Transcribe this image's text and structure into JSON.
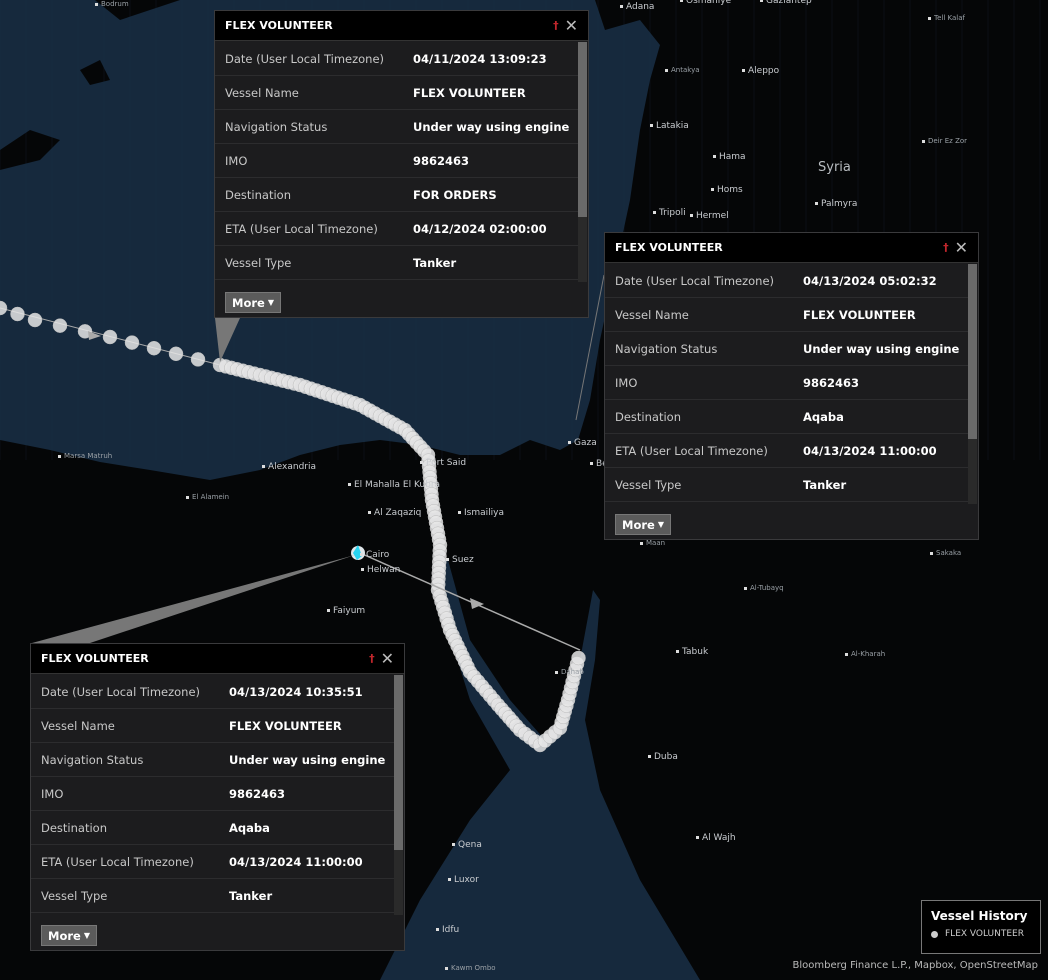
{
  "map": {
    "labels": [
      "Bodrum",
      "Adana",
      "Osmaniye",
      "Gaziantep",
      "Tell Kalaf",
      "Antakya",
      "Aleppo",
      "Latakia",
      "Hama",
      "Syria",
      "Deir Ez Zor",
      "Homs",
      "Tripoli",
      "Hermel",
      "Palmyra",
      "Marsa Matruh",
      "Alexandria",
      "El Mahalla El Kubra",
      "El Alamein",
      "Al Zaqaziq",
      "Ismailiya",
      "Port Said",
      "Gaza",
      "Beersheba",
      "Cairo",
      "Helwan",
      "Suez",
      "Faiyum",
      "Dahab",
      "Tabuk",
      "Duba",
      "Al Wajh",
      "Qena",
      "Luxor",
      "Idfu",
      "Kawm Ombo",
      "Maan",
      "Al-Tubayq",
      "Sakaka",
      "Al-Kharah"
    ],
    "track_color": "#e6e6e6",
    "sea_color": "#16293d",
    "current_position_color": "#27d3f0"
  },
  "popups": [
    {
      "title": "FLEX VOLUNTEER",
      "rows": [
        {
          "k": "Date (User Local Timezone)",
          "v": "04/11/2024 13:09:23"
        },
        {
          "k": "Vessel Name",
          "v": "FLEX VOLUNTEER"
        },
        {
          "k": "Navigation Status",
          "v": "Under way using engine"
        },
        {
          "k": "IMO",
          "v": "9862463"
        },
        {
          "k": "Destination",
          "v": "FOR ORDERS"
        },
        {
          "k": "ETA (User Local Timezone)",
          "v": "04/12/2024 02:00:00"
        },
        {
          "k": "Vessel Type",
          "v": "Tanker"
        }
      ],
      "more": "More"
    },
    {
      "title": "FLEX VOLUNTEER",
      "rows": [
        {
          "k": "Date (User Local Timezone)",
          "v": "04/13/2024 05:02:32"
        },
        {
          "k": "Vessel Name",
          "v": "FLEX VOLUNTEER"
        },
        {
          "k": "Navigation Status",
          "v": "Under way using engine"
        },
        {
          "k": "IMO",
          "v": "9862463"
        },
        {
          "k": "Destination",
          "v": "Aqaba"
        },
        {
          "k": "ETA (User Local Timezone)",
          "v": "04/13/2024 11:00:00"
        },
        {
          "k": "Vessel Type",
          "v": "Tanker"
        }
      ],
      "more": "More"
    },
    {
      "title": "FLEX VOLUNTEER",
      "rows": [
        {
          "k": "Date (User Local Timezone)",
          "v": "04/13/2024 10:35:51"
        },
        {
          "k": "Vessel Name",
          "v": "FLEX VOLUNTEER"
        },
        {
          "k": "Navigation Status",
          "v": "Under way using engine"
        },
        {
          "k": "IMO",
          "v": "9862463"
        },
        {
          "k": "Destination",
          "v": "Aqaba"
        },
        {
          "k": "ETA (User Local Timezone)",
          "v": "04/13/2024 11:00:00"
        },
        {
          "k": "Vessel Type",
          "v": "Tanker"
        }
      ],
      "more": "More"
    }
  ],
  "legend": {
    "title": "Vessel History",
    "item": "FLEX VOLUNTEER"
  },
  "attribution": "Bloomberg Finance L.P., Mapbox, OpenStreetMap"
}
